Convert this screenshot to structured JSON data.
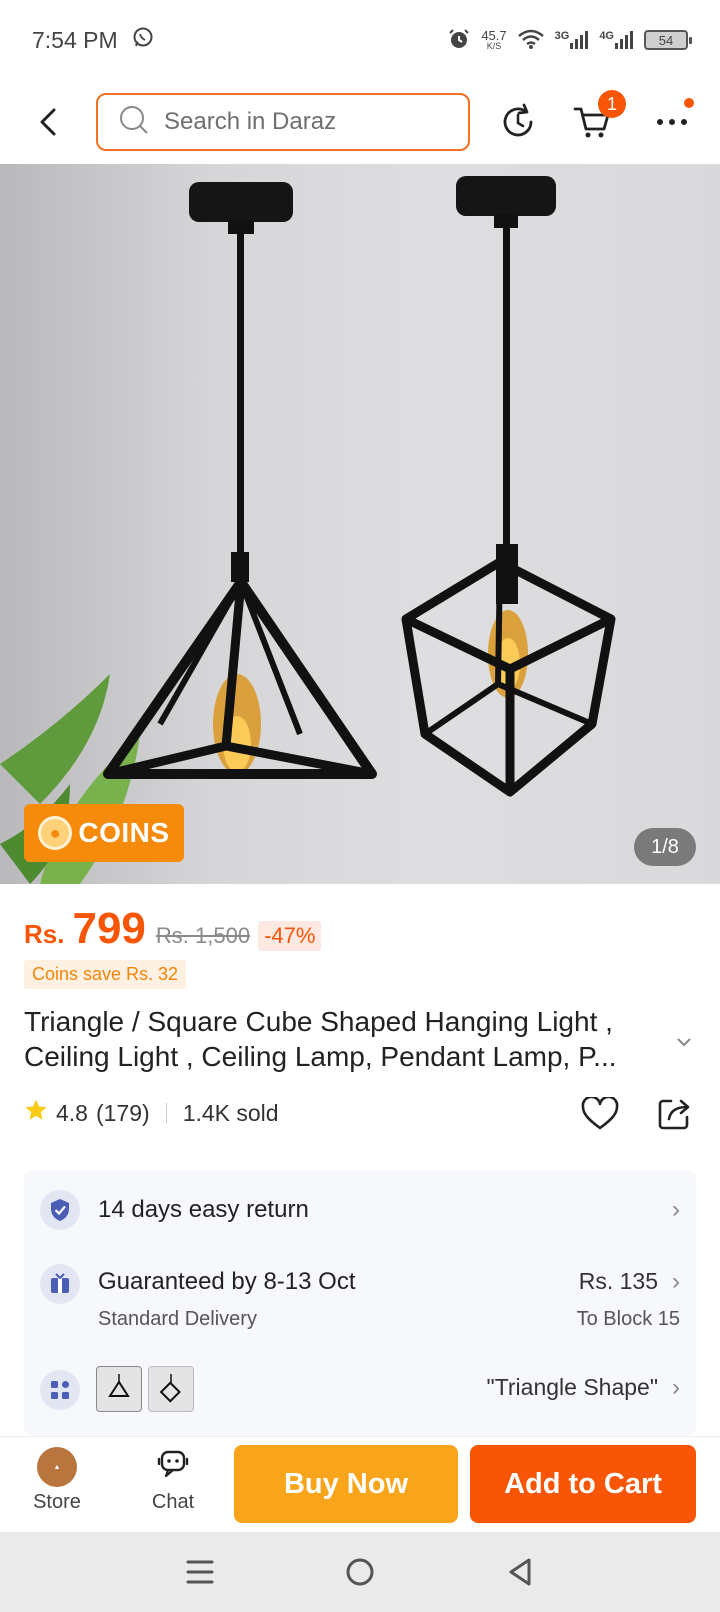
{
  "status_bar": {
    "time": "7:54 PM",
    "speed_value": "45.7",
    "speed_unit": "K/S",
    "net1": "3G",
    "net2": "4G",
    "battery": "54"
  },
  "header": {
    "search_placeholder": "Search in Daraz",
    "cart_count": "1"
  },
  "gallery": {
    "coins_label": "COINS",
    "page_indicator": "1/8"
  },
  "price": {
    "currency": "Rs.",
    "value": "799",
    "original": "Rs. 1,500",
    "discount": "-47%",
    "coins_save": "Coins save Rs. 32"
  },
  "product": {
    "title": "Triangle / Square Cube Shaped Hanging Light , Ceiling Light , Ceiling Lamp, Pendant Lamp, P...",
    "rating": "4.8",
    "reviews": "(179)",
    "sold": "1.4K sold"
  },
  "info": {
    "return_text": "14 days easy return",
    "delivery_text": "Guaranteed by 8-13 Oct",
    "delivery_type": "Standard Delivery",
    "delivery_price": "Rs. 135",
    "delivery_location": "To Block 15",
    "variant_selected": "\"Triangle Shape\""
  },
  "bottom_bar": {
    "store_label": "Store",
    "chat_label": "Chat",
    "buy_now": "Buy Now",
    "add_to_cart": "Add to Cart"
  },
  "colors": {
    "brand_orange": "#f85606",
    "buy_yellow": "#f9a51b",
    "coins_orange": "#f58a0b"
  }
}
